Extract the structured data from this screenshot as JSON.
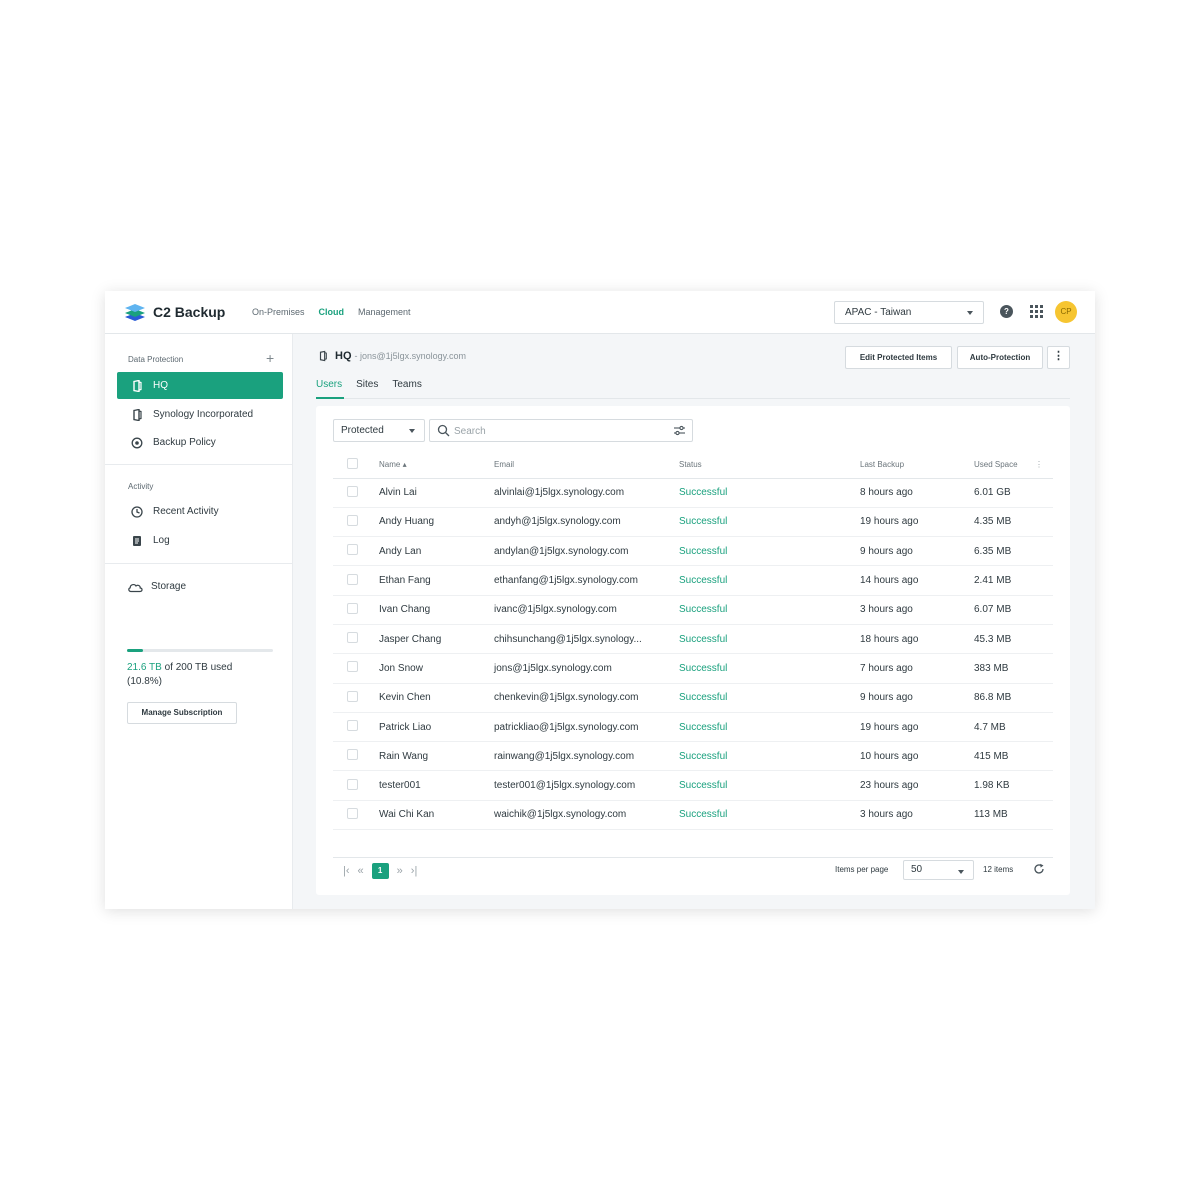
{
  "app": {
    "title": "C2 Backup",
    "avatar_initials": "CP"
  },
  "top_nav": {
    "items": [
      "On-Premises",
      "Cloud",
      "Management"
    ],
    "active": "Cloud"
  },
  "region": {
    "selected": "APAC - Taiwan"
  },
  "sidebar": {
    "data_protection_title": "Data Protection",
    "data_protection_items": [
      {
        "label": "HQ",
        "icon": "office-icon",
        "active": true
      },
      {
        "label": "Synology Incorporated",
        "icon": "office-icon",
        "active": false
      },
      {
        "label": "Backup Policy",
        "icon": "policy-icon",
        "active": false
      }
    ],
    "activity_title": "Activity",
    "activity_items": [
      {
        "label": "Recent Activity",
        "icon": "clock-icon"
      },
      {
        "label": "Log",
        "icon": "log-icon"
      }
    ],
    "storage": {
      "label": "Storage",
      "used": "21.6 TB",
      "rest": "of 200 TB used",
      "percent_text": "(10.8%)",
      "fraction": 0.108,
      "manage_label": "Manage Subscription"
    }
  },
  "main": {
    "title": "HQ",
    "subtitle": "- jons@1j5lgx.synology.com",
    "edit_button": "Edit Protected Items",
    "auto_button": "Auto-Protection",
    "tabs": [
      "Users",
      "Sites",
      "Teams"
    ],
    "active_tab": "Users",
    "filter_value": "Protected",
    "search_placeholder": "Search",
    "columns": [
      "Name",
      "Email",
      "Status",
      "Last Backup",
      "Used Space"
    ],
    "sort_indicator": "▴",
    "rows": [
      {
        "name": "Alvin Lai",
        "email": "alvinlai@1j5lgx.synology.com",
        "status": "Successful",
        "last_backup": "8 hours ago",
        "used": "6.01 GB"
      },
      {
        "name": "Andy Huang",
        "email": "andyh@1j5lgx.synology.com",
        "status": "Successful",
        "last_backup": "19 hours ago",
        "used": "4.35 MB"
      },
      {
        "name": "Andy Lan",
        "email": "andylan@1j5lgx.synology.com",
        "status": "Successful",
        "last_backup": "9 hours ago",
        "used": "6.35 MB"
      },
      {
        "name": "Ethan Fang",
        "email": "ethanfang@1j5lgx.synology.com",
        "status": "Successful",
        "last_backup": "14 hours ago",
        "used": "2.41 MB"
      },
      {
        "name": "Ivan Chang",
        "email": "ivanc@1j5lgx.synology.com",
        "status": "Successful",
        "last_backup": "3 hours ago",
        "used": "6.07 MB"
      },
      {
        "name": "Jasper Chang",
        "email": "chihsunchang@1j5lgx.synology...",
        "status": "Successful",
        "last_backup": "18 hours ago",
        "used": "45.3 MB"
      },
      {
        "name": "Jon Snow",
        "email": "jons@1j5lgx.synology.com",
        "status": "Successful",
        "last_backup": "7 hours ago",
        "used": "383 MB"
      },
      {
        "name": "Kevin Chen",
        "email": "chenkevin@1j5lgx.synology.com",
        "status": "Successful",
        "last_backup": "9 hours ago",
        "used": "86.8 MB"
      },
      {
        "name": "Patrick Liao",
        "email": "patrickliao@1j5lgx.synology.com",
        "status": "Successful",
        "last_backup": "19 hours ago",
        "used": "4.7 MB"
      },
      {
        "name": "Rain Wang",
        "email": "rainwang@1j5lgx.synology.com",
        "status": "Successful",
        "last_backup": "10 hours ago",
        "used": "415 MB"
      },
      {
        "name": "tester001",
        "email": "tester001@1j5lgx.synology.com",
        "status": "Successful",
        "last_backup": "23 hours ago",
        "used": "1.98 KB"
      },
      {
        "name": "Wai Chi Kan",
        "email": "waichik@1j5lgx.synology.com",
        "status": "Successful",
        "last_backup": "3 hours ago",
        "used": "113 MB"
      }
    ],
    "pagination": {
      "current_page": "1",
      "items_per_page_label": "Items per page",
      "items_per_page": "50",
      "items_count": "12 items"
    }
  },
  "colors": {
    "accent": "#1aa17e",
    "avatar": "#f6c531"
  }
}
